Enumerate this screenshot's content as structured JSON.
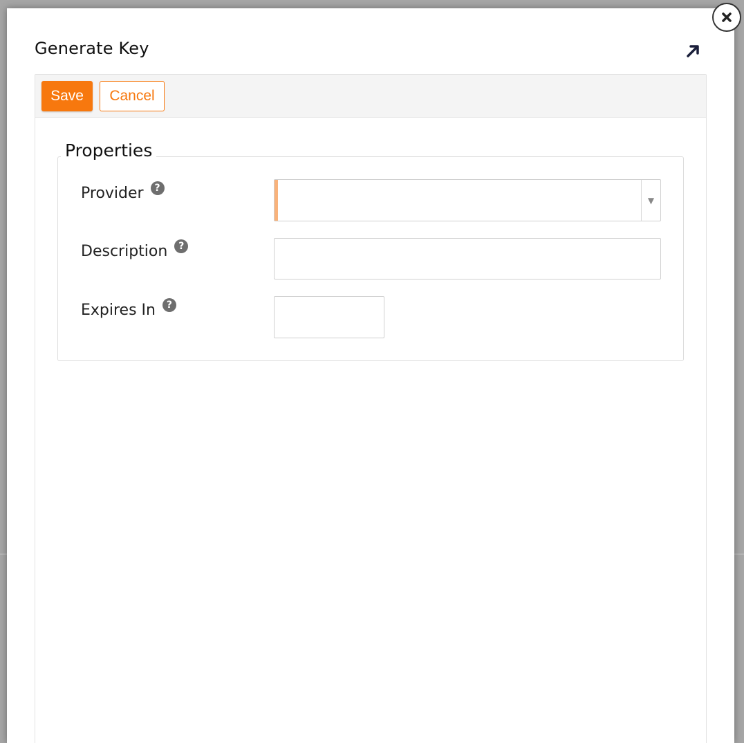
{
  "dialog": {
    "title": "Generate Key",
    "close_icon": "close-icon",
    "expand_icon": "expand-arrow-icon"
  },
  "toolbar": {
    "save_label": "Save",
    "cancel_label": "Cancel"
  },
  "properties": {
    "legend": "Properties",
    "provider": {
      "label": "Provider",
      "value": "",
      "help_icon": "help-icon"
    },
    "description": {
      "label": "Description",
      "value": "",
      "help_icon": "help-icon"
    },
    "expires_in": {
      "label": "Expires In",
      "value": "",
      "help_icon": "help-icon"
    }
  },
  "colors": {
    "accent": "#f7780e",
    "required_marker": "#f9b27a"
  }
}
